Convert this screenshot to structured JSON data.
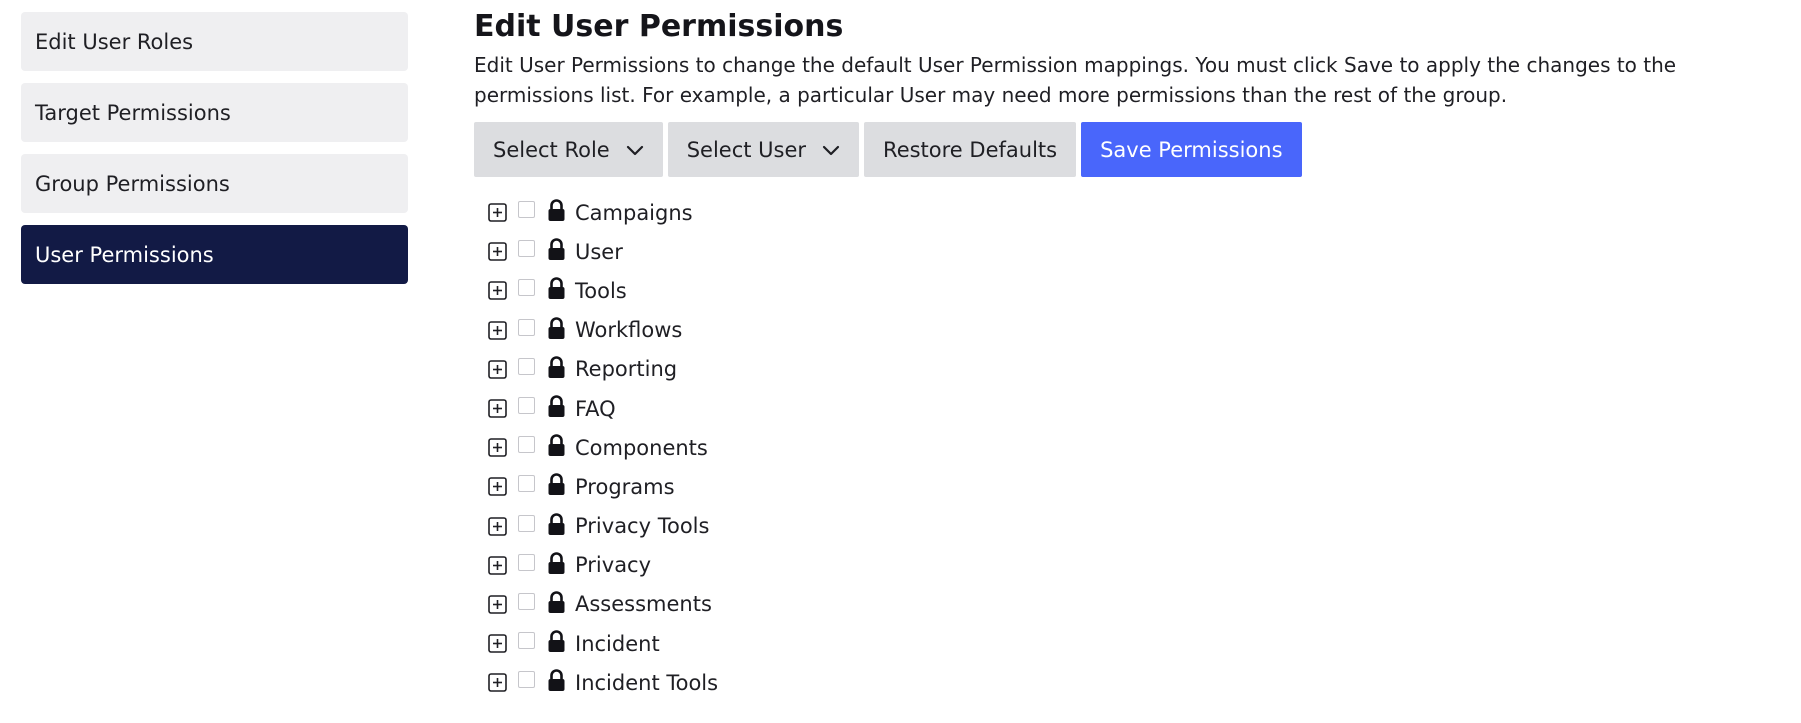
{
  "sidebar": {
    "items": [
      {
        "label": "Edit User Roles",
        "active": false
      },
      {
        "label": "Target Permissions",
        "active": false
      },
      {
        "label": "Group Permissions",
        "active": false
      },
      {
        "label": "User Permissions",
        "active": true
      }
    ]
  },
  "main": {
    "title": "Edit User Permissions",
    "description_line1": "Edit User Permissions to change the default User Permission mappings. You must click Save to apply the changes to the",
    "description_line2": "permissions list. For example, a particular User may need more permissions than the rest of the group."
  },
  "toolbar": {
    "select_role_label": "Select Role",
    "select_user_label": "Select User",
    "restore_defaults_label": "Restore Defaults",
    "save_permissions_label": "Save Permissions"
  },
  "tree": {
    "items": [
      {
        "label": "Campaigns"
      },
      {
        "label": "User"
      },
      {
        "label": "Tools"
      },
      {
        "label": "Workflows"
      },
      {
        "label": "Reporting"
      },
      {
        "label": "FAQ"
      },
      {
        "label": "Components"
      },
      {
        "label": "Programs"
      },
      {
        "label": "Privacy Tools"
      },
      {
        "label": "Privacy"
      },
      {
        "label": "Assessments"
      },
      {
        "label": "Incident"
      },
      {
        "label": "Incident Tools"
      }
    ]
  },
  "colors": {
    "sidebar_active_bg": "#121a45",
    "sidebar_bg": "#efeff1",
    "button_bg": "#dcdde0",
    "primary_button_bg": "#4966fb"
  },
  "icons": {
    "dropdown": "chevron-down-icon",
    "expander": "plus-square-icon",
    "lock": "lock-icon"
  }
}
